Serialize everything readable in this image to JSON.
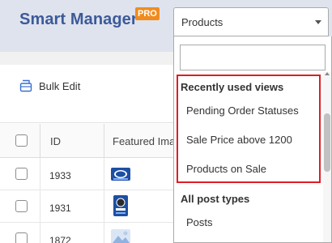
{
  "header": {
    "title": "Smart Manager",
    "badge": "PRO",
    "select_value": "Products"
  },
  "toolbar": {
    "bulk_edit_label": "Bulk Edit"
  },
  "grid": {
    "columns": {
      "id": "ID",
      "featured_image": "Featured Ima"
    },
    "rows": [
      {
        "id": "1933",
        "image": "oreo-cookies-pack"
      },
      {
        "id": "1931",
        "image": "oreo-cookie-box"
      },
      {
        "id": "1872",
        "image": "product-thumbnail"
      }
    ]
  },
  "dropdown": {
    "search_placeholder": "",
    "groups": [
      {
        "label": "Recently used views",
        "options": [
          "Pending Order Statuses",
          "Sale Price above 1200",
          "Products on Sale"
        ]
      },
      {
        "label": "All post types",
        "options": [
          "Posts"
        ]
      }
    ]
  },
  "colors": {
    "brand": "#3c5a99",
    "badge": "#f08c1f",
    "highlight": "#e01c24"
  }
}
